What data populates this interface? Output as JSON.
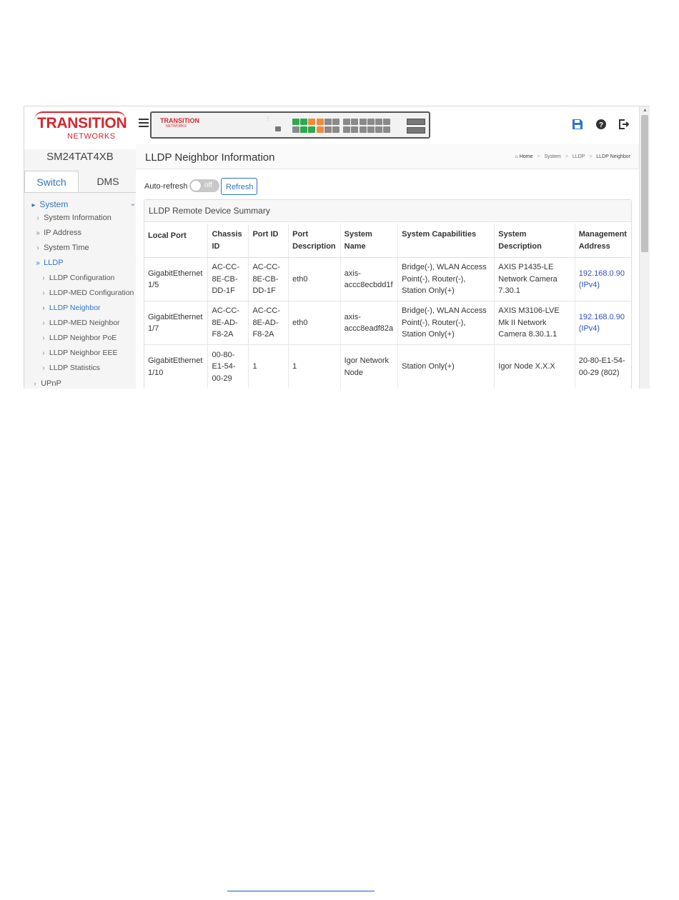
{
  "brand": {
    "logo_line1": "TRANSITION",
    "logo_line2": "NETWORKS",
    "device_name": "SM24TAT4XB"
  },
  "tabs": [
    {
      "label": "Switch",
      "active": true
    },
    {
      "label": "DMS",
      "active": false
    }
  ],
  "sidebar": {
    "items": [
      {
        "label": "System",
        "level": 0,
        "active": true,
        "expanded": true
      },
      {
        "label": "System Information",
        "level": 1
      },
      {
        "label": "IP Address",
        "level": 1,
        "collapsible": true
      },
      {
        "label": "System Time",
        "level": 1
      },
      {
        "label": "LLDP",
        "level": 1,
        "active": true,
        "expanded": true
      },
      {
        "label": "LLDP Configuration",
        "level": 2
      },
      {
        "label": "LLDP-MED Configuration",
        "level": 2
      },
      {
        "label": "LLDP Neighbor",
        "level": 2,
        "active": true
      },
      {
        "label": "LLDP-MED Neighbor",
        "level": 2
      },
      {
        "label": "LLDP Neighbor PoE",
        "level": 2
      },
      {
        "label": "LLDP Neighbor EEE",
        "level": 2
      },
      {
        "label": "LLDP Statistics",
        "level": 2
      },
      {
        "label": "UPnP",
        "level": 1
      }
    ]
  },
  "device_panel": {
    "logo": "TRANSITION",
    "logo_sub": "NETWORKS",
    "port_colors": {
      "up": "#2fa84f",
      "warn": "#f08a3c",
      "down": "#8a8a8a"
    }
  },
  "header_icons": [
    "save-icon",
    "help-icon",
    "logout-icon"
  ],
  "page": {
    "title": "LLDP Neighbor Information",
    "breadcrumb": [
      "Home",
      "System",
      "LLDP",
      "LLDP Neighbor"
    ],
    "auto_refresh_label": "Auto-refresh",
    "toggle_state": "off",
    "refresh_label": "Refresh",
    "panel_title": "LLDP Remote Device Summary"
  },
  "table": {
    "headers": [
      "Local Port",
      "Chassis ID",
      "Port ID",
      "Port Description",
      "System Name",
      "System Capabilities",
      "System Description",
      "Management Address"
    ],
    "rows": [
      {
        "local_port": "GigabitEthernet 1/5",
        "chassis_id": "AC-CC-8E-CB-DD-1F",
        "port_id": "AC-CC-8E-CB-DD-1F",
        "port_description": "eth0",
        "system_name": "axis-accc8ecbdd1f",
        "capabilities": "Bridge(-), WLAN Access Point(-), Router(-), Station Only(+)",
        "system_description": "AXIS P1435-LE Network Camera 7.30.1",
        "management_address": "192.168.0.90 (IPv4)",
        "management_link": true
      },
      {
        "local_port": "GigabitEthernet 1/7",
        "chassis_id": "AC-CC-8E-AD-F8-2A",
        "port_id": "AC-CC-8E-AD-F8-2A",
        "port_description": "eth0",
        "system_name": "axis-accc8eadf82a",
        "capabilities": "Bridge(-), WLAN Access Point(-), Router(-), Station Only(+)",
        "system_description": "AXIS M3106-LVE Mk II Network Camera 8.30.1.1",
        "management_address": "192.168.0.90 (IPv4)",
        "management_link": true
      },
      {
        "local_port": "GigabitEthernet 1/10",
        "chassis_id": "00-80-E1-54-00-29",
        "port_id": "1",
        "port_description": "1",
        "system_name": "Igor Network Node",
        "capabilities": "Station Only(+)",
        "system_description": "Igor Node X.X.X",
        "management_address": "20-80-E1-54-00-29 (802)",
        "management_link": false
      }
    ]
  }
}
